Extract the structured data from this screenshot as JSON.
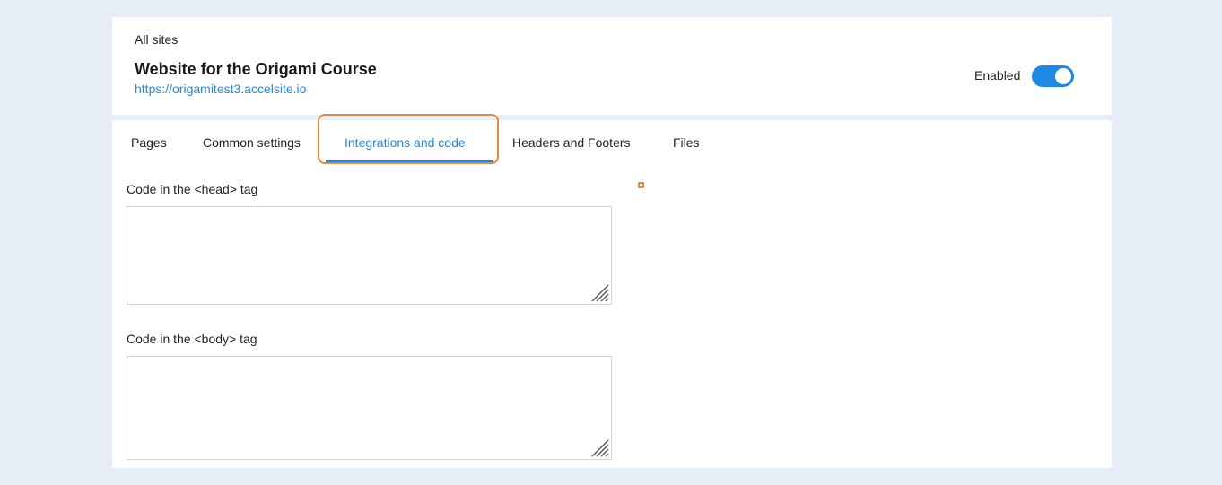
{
  "header": {
    "breadcrumb": "All sites",
    "site_title": "Website for the Origami Course",
    "site_url": "https://origamitest3.accelsite.io",
    "status_label": "Enabled",
    "enabled": true
  },
  "tabs": [
    {
      "label": "Pages",
      "active": false
    },
    {
      "label": "Common settings",
      "active": false
    },
    {
      "label": "Integrations and code",
      "active": true
    },
    {
      "label": "Headers and Footers",
      "active": false
    },
    {
      "label": "Files",
      "active": false
    }
  ],
  "fields": {
    "head_code": {
      "label": "Code in the <head> tag",
      "value": ""
    },
    "body_code": {
      "label": "Code in the <body> tag",
      "value": ""
    }
  },
  "colors": {
    "accent": "#1e88e5",
    "highlight": "#e8893a",
    "background": "#e6edf6"
  }
}
